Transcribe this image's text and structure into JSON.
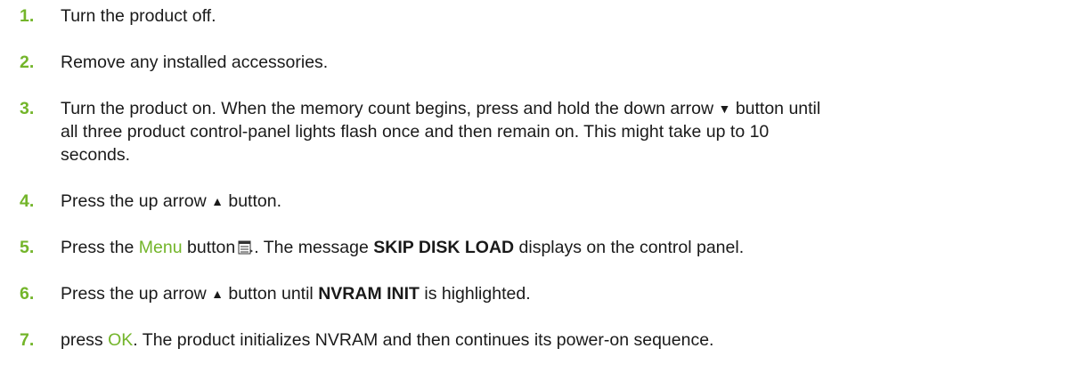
{
  "accent_color": "#73b52a",
  "steps": [
    {
      "num": "1.",
      "text": "Turn the product off."
    },
    {
      "num": "2.",
      "text": "Remove any installed accessories."
    },
    {
      "num": "3.",
      "text_a": "Turn the product on. When the memory count begins, press and hold the down arrow",
      "down_glyph": "▼",
      "text_b": "button until",
      "text_c": "all three product control-panel lights flash once and then remain on. This might take up to 10",
      "text_d": "seconds."
    },
    {
      "num": "4.",
      "text_a": "Press the up arrow",
      "up_glyph": "▲",
      "text_b": "button."
    },
    {
      "num": "5.",
      "text_a": "Press the",
      "menu_label": "Menu",
      "text_b": "button",
      "text_c": ". The message",
      "message": "SKIP DISK LOAD",
      "text_d": "displays on the control panel.",
      "icon": "menu-icon"
    },
    {
      "num": "6.",
      "text_a": "Press the up arrow",
      "up_glyph": "▲",
      "text_b": "button until",
      "highlight": "NVRAM INIT",
      "text_c": "is highlighted."
    },
    {
      "num": "7.",
      "text_a": "press",
      "ok_label": "OK",
      "text_b": ". The product initializes NVRAM and then continues its power-on sequence."
    }
  ]
}
